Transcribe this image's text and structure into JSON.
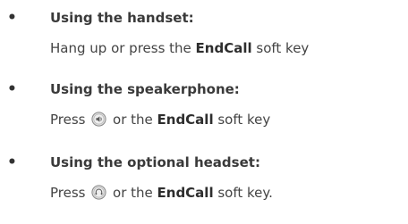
{
  "items": [
    {
      "bullet": "•",
      "heading": "Using the handset:",
      "line_pre": "Hang up or press the ",
      "key_label": "EndCall",
      "line_post": " soft key",
      "icon": null
    },
    {
      "bullet": "•",
      "heading": "Using the speakerphone:",
      "line_pre": "Press ",
      "icon": "speakerphone-key-icon",
      "line_mid": " or the ",
      "key_label": "EndCall",
      "line_post": " soft key"
    },
    {
      "bullet": "•",
      "heading": "Using the optional headset:",
      "line_pre": "Press ",
      "icon": "headset-key-icon",
      "line_mid": " or the ",
      "key_label": "EndCall",
      "line_post": " soft key."
    }
  ],
  "colors": {
    "text": "#444444",
    "icon_fill": "#d9d9d9",
    "icon_stroke": "#8a8a8a"
  }
}
